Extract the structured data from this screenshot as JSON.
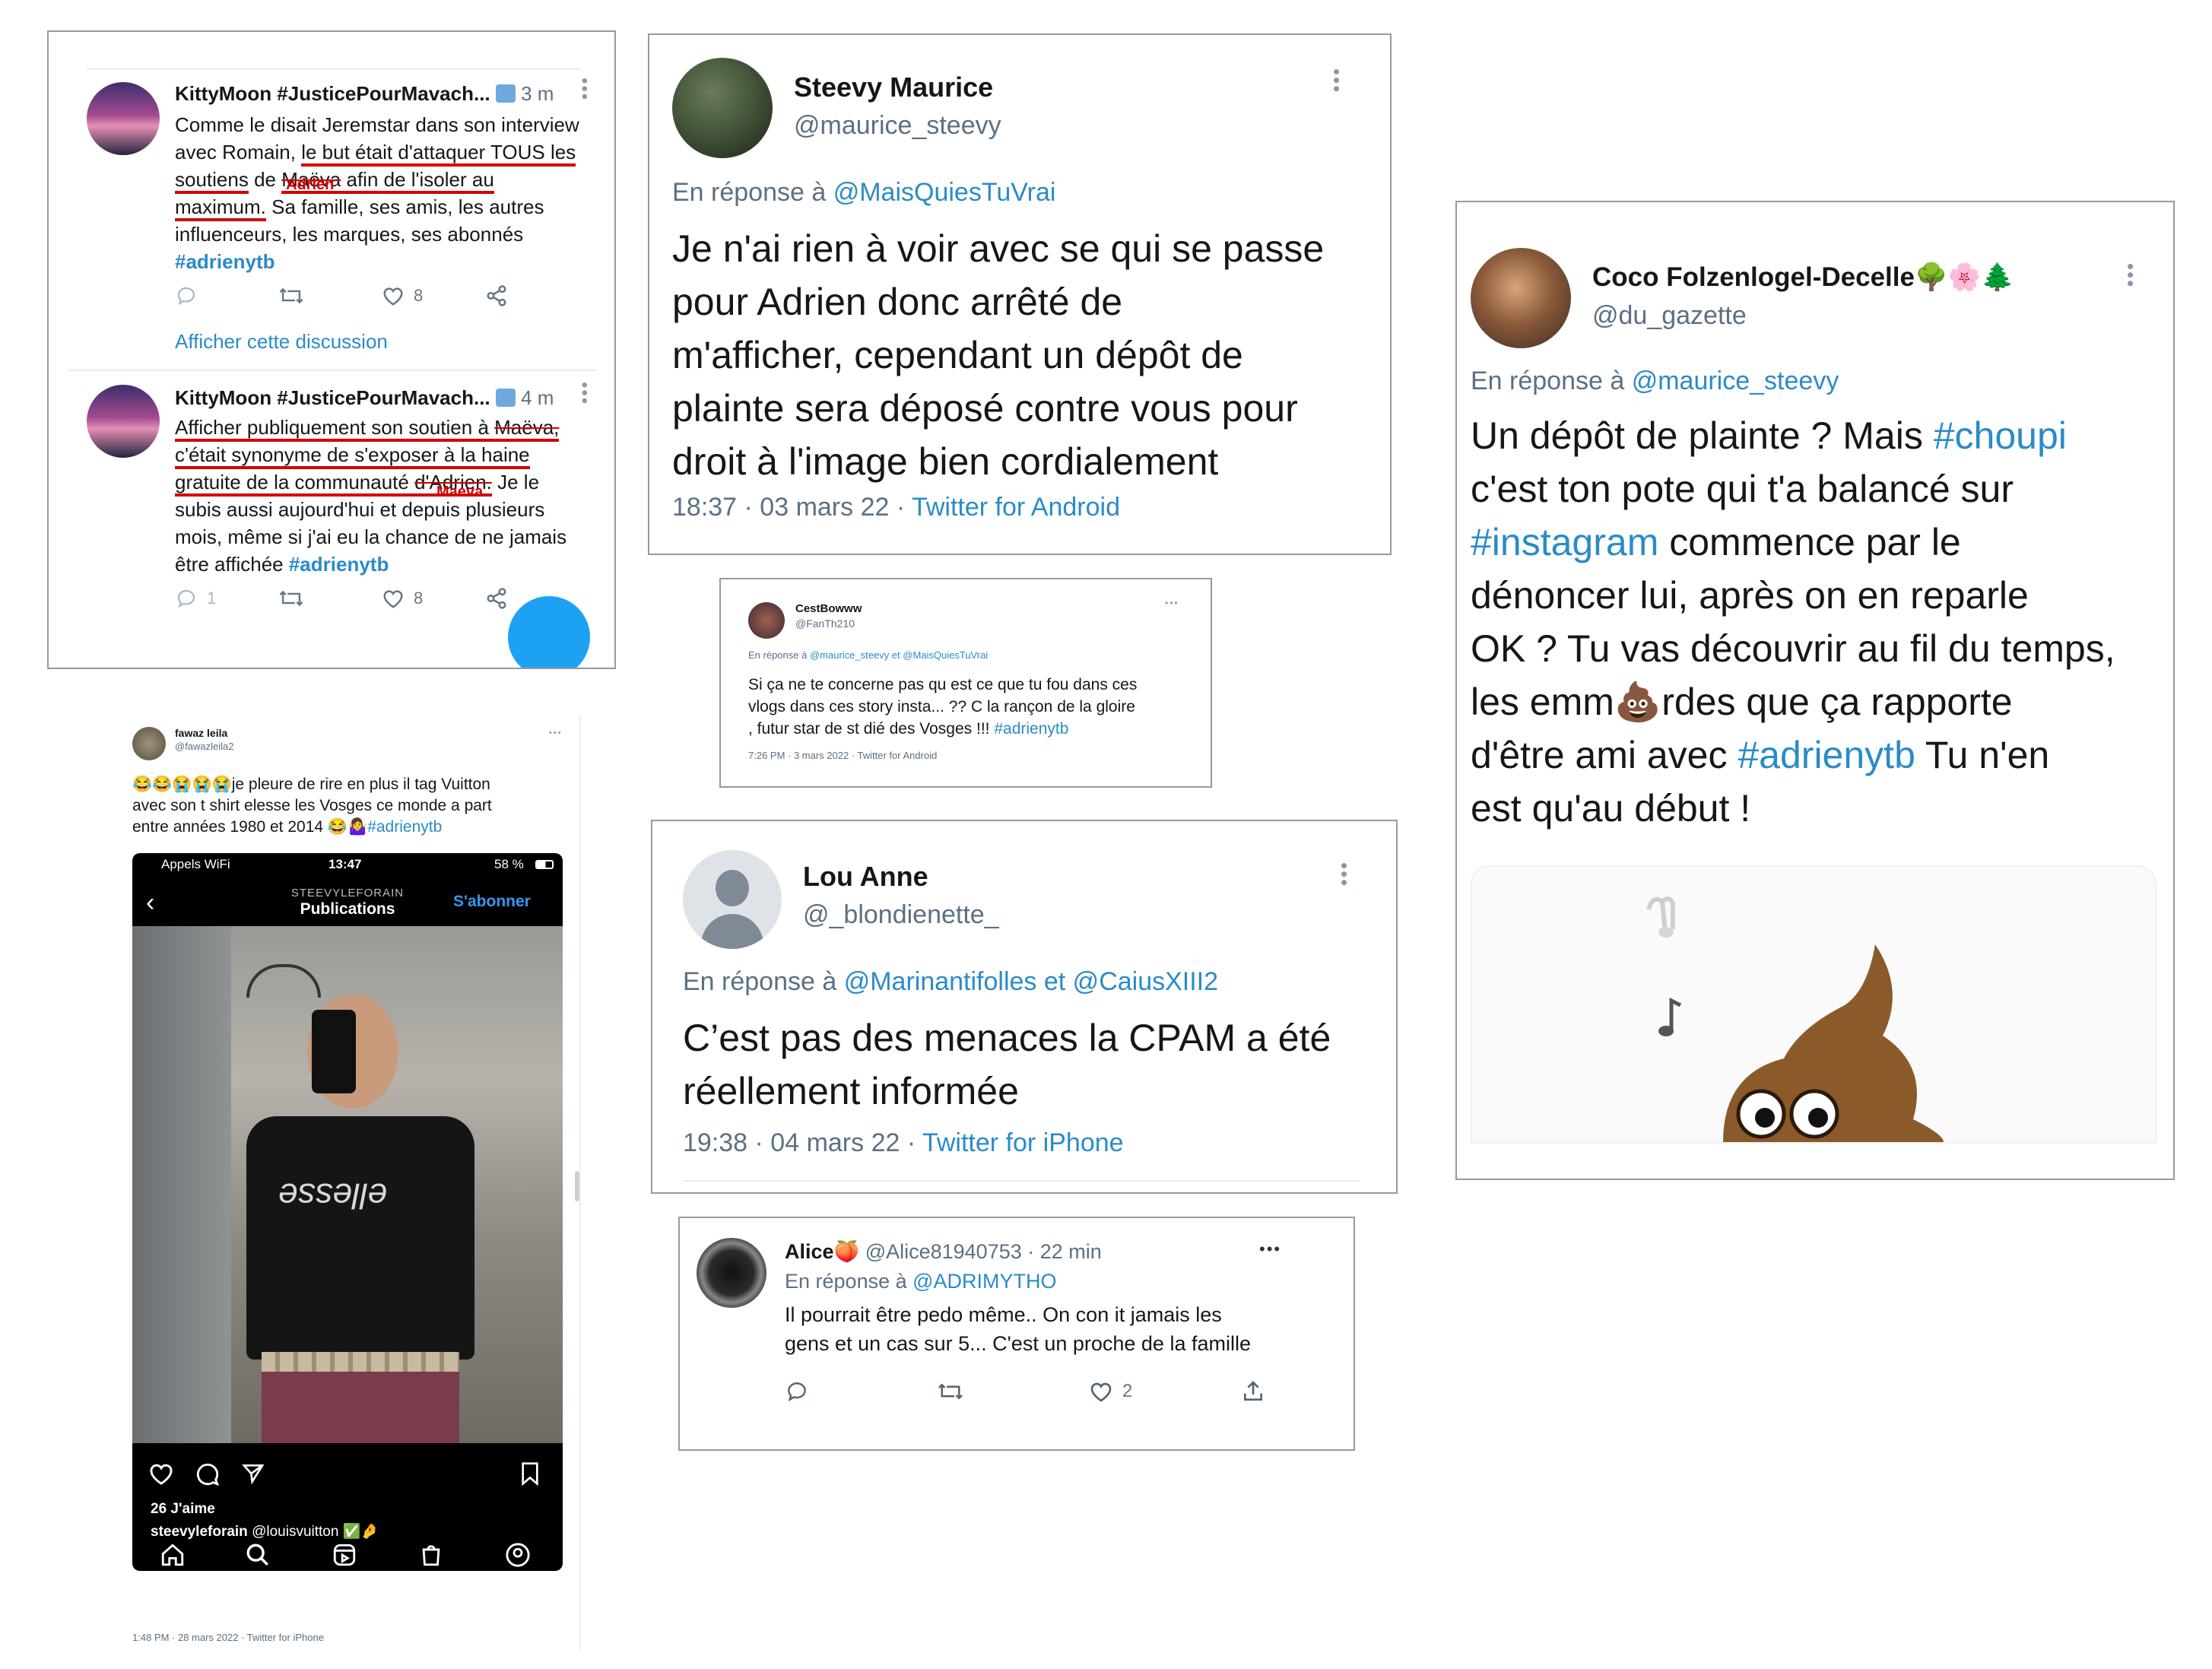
{
  "card1": {
    "tweet1": {
      "author": "KittyMoon #JusticePourMavach...",
      "time": "3 m",
      "text": {
        "p1": "Comme le disait Jeremstar dans son interview",
        "p2": "avec Romain, ",
        "p3": "le but était d'attaquer TOUS les",
        "p4": "soutiens",
        "p5": " de ",
        "p6": "Maëva",
        "p7": " afin de l'isoler au",
        "p8": "maximum.",
        "p9": " Sa famille, ses amis, les autres",
        "p10": "influenceurs, les marques, ses abonnés"
      },
      "hashtag": "#adrienytb",
      "annotation": "Adrien",
      "likes": "8"
    },
    "show_thread": "Afficher cette discussion",
    "tweet2": {
      "author": "KittyMoon #JusticePourMavach...",
      "time": "4 m",
      "text": {
        "p1": "Afficher publiquement son soutien à ",
        "p2": "Maëva,",
        "p3": "c'était synonyme de s'exposer à la haine",
        "p4": "gratuite de la communauté ",
        "p5": "d'Adrien.",
        "p6": " Je le",
        "p7": "subis aussi aujourd'hui et depuis plusieurs",
        "p8": "mois, même si j'ai eu la chance de ne jamais",
        "p9": "être affichée "
      },
      "hashtag": "#adrienytb",
      "annotation": "Maeva",
      "replies": "1",
      "likes": "8"
    }
  },
  "card2": {
    "name": "Steevy Maurice",
    "handle": "@maurice_steevy",
    "reply_prefix": "En réponse à ",
    "reply_to": "@MaisQuiesTuVrai",
    "lines": [
      "Je n'ai rien à voir avec se qui se passe",
      "pour Adrien donc arrêté de",
      "m'afficher, cependant un dépôt de",
      "plainte sera déposé contre vous pour",
      "droit à l'image bien cordialement"
    ],
    "meta_time": "18:37 · 03 mars 22 · ",
    "meta_app": "Twitter for Android"
  },
  "card3": {
    "name": "CestBowww",
    "handle": "@FanTh210",
    "reply_prefix": "En réponse à ",
    "reply_to": "@maurice_steevy  et  @MaisQuiesTuVrai",
    "lines": [
      "Si ça ne te concerne pas qu est ce que tu fou dans ces",
      "vlogs dans ces story insta... ?? C la rançon de la gloire",
      ", futur star de st dié des Vosges !!! "
    ],
    "hashtag": "#adrienytb",
    "meta": "7:26 PM · 3 mars 2022 · Twitter for Android"
  },
  "card4": {
    "name": "Lou Anne",
    "handle": "@_blondienette_",
    "reply_prefix": "En réponse à ",
    "reply_to": "@Marinantifolles et @CaiusXIII2",
    "lines": [
      "C’est pas des menaces la CPAM a été",
      "réellement informée"
    ],
    "meta_time": "19:38 · 04 mars 22 · ",
    "meta_app": "Twitter for iPhone"
  },
  "card5": {
    "name": "Alice",
    "emoji": "🍑",
    "handle": "@Alice81940753 · 22 min",
    "reply_prefix": "En réponse à ",
    "reply_to": "@ADRIMYTHO",
    "lines": [
      "Il pourrait être pedo même.. On con it jamais les",
      "gens et un cas sur 5... C'est un proche de la famille"
    ],
    "likes": "2"
  },
  "card6": {
    "name": "Coco Folzenlogel-Decelle",
    "name_emoji": "🌳🌸🌲",
    "handle": "@du_gazette",
    "reply_prefix": "En réponse à ",
    "reply_to": "@maurice_steevy",
    "t1": "Un dépôt de plainte ? Mais ",
    "h1": "#choupi",
    "t2": "c'est ton pote qui t'a balancé sur",
    "h2": "#instagram",
    "t3": " commence par le",
    "t4": "dénoncer lui, après on en reparle",
    "t5": "OK ? Tu vas découvrir au fil du temps,",
    "t6a": "les emm",
    "t6emoji": "💩",
    "t6b": "rdes que ça rapporte",
    "t7a": "d'être ami avec ",
    "h3": "#adrienytb",
    "t7b": " Tu n'en",
    "t8": "est qu'au début !"
  },
  "card7": {
    "name": "fawaz leila",
    "handle": "@fawazleila2",
    "emojis": "😂😂😭😭😭",
    "l1": "je pleure de rire en plus il tag Vuitton",
    "l2": "avec son t shirt elesse les Vosges ce monde a part",
    "l3": "entre années 1980 et 2014 ",
    "l3emoji": "😂🤷‍♀️",
    "hashtag": "#adrienytb",
    "footer": "1:48 PM · 28 mars 2022 · Twitter for iPhone",
    "insta": {
      "carrier": "Appels WiFi",
      "clock": "13:47",
      "battery": "58 %",
      "account": "STEEVYLEFORAIN",
      "title": "Publications",
      "follow": "S'abonner",
      "shirt_text": "ellesse",
      "likes": "26 J'aime",
      "caption_user": "steevyleforain",
      "caption_rest": " @louisvuitton ✅🤌"
    }
  }
}
